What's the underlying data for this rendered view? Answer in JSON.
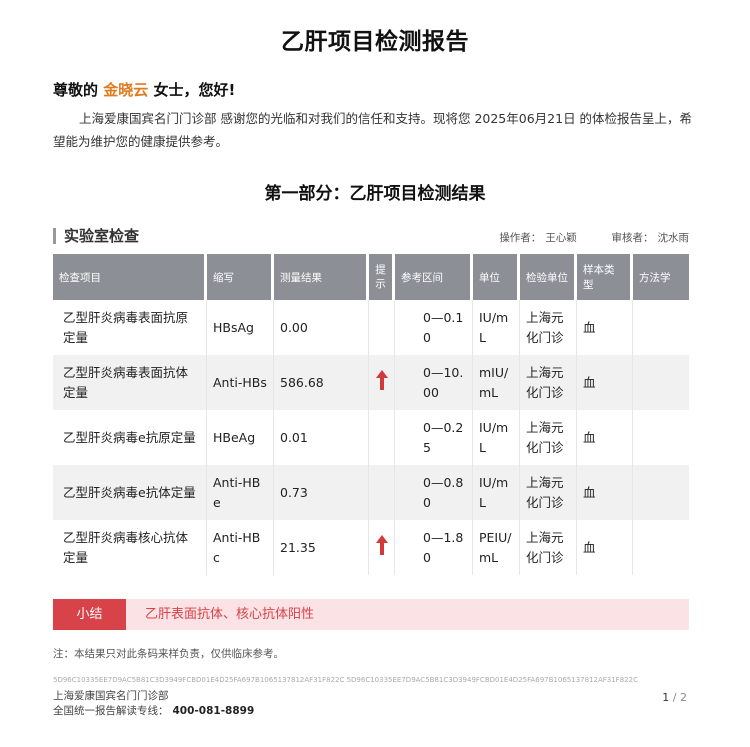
{
  "report": {
    "title": "乙肝项目检测报告"
  },
  "greeting": {
    "prefix": "尊敬的",
    "name": "金晓云",
    "suffix": "女士，您好!"
  },
  "intro": "上海爱康国宾名门门诊部 感谢您的光临和对我们的信任和支持。现将您 2025年06月21日 的体检报告呈上，希望能为维护您的健康提供参考。",
  "section": {
    "title": "第一部分：乙肝项目检测结果"
  },
  "lab": {
    "title": "实验室检查",
    "operator_label": "操作者：",
    "operator": "王心颖",
    "reviewer_label": "审核者：",
    "reviewer": "沈水雨"
  },
  "table": {
    "headers": [
      "检查项目",
      "缩写",
      "测量结果",
      "提示",
      "参考区间",
      "单位",
      "检验单位",
      "样本类型",
      "方法学"
    ],
    "rows": [
      {
        "item": "乙型肝炎病毒表面抗原定量",
        "abbr": "HBsAg",
        "result": "0.00",
        "flag": "",
        "range": "0—0.10",
        "unit": "IU/mL",
        "lab": "上海元化门诊",
        "sample": "血",
        "method": ""
      },
      {
        "item": "乙型肝炎病毒表面抗体定量",
        "abbr": "Anti-HBs",
        "result": "586.68",
        "flag": "up",
        "range": "0—10.00",
        "unit": "mIU/mL",
        "lab": "上海元化门诊",
        "sample": "血",
        "method": ""
      },
      {
        "item": "乙型肝炎病毒e抗原定量",
        "abbr": "HBeAg",
        "result": "0.01",
        "flag": "",
        "range": "0—0.25",
        "unit": "IU/mL",
        "lab": "上海元化门诊",
        "sample": "血",
        "method": ""
      },
      {
        "item": "乙型肝炎病毒e抗体定量",
        "abbr": "Anti-HBe",
        "result": "0.73",
        "flag": "",
        "range": "0—0.80",
        "unit": "IU/mL",
        "lab": "上海元化门诊",
        "sample": "血",
        "method": ""
      },
      {
        "item": "乙型肝炎病毒核心抗体定量",
        "abbr": "Anti-HBc",
        "result": "21.35",
        "flag": "up",
        "range": "0—1.80",
        "unit": "PEIU/mL",
        "lab": "上海元化门诊",
        "sample": "血",
        "method": ""
      }
    ]
  },
  "summary": {
    "label": "小结",
    "text": "乙肝表面抗体、核心抗体阳性"
  },
  "note": "注：本结果只对此条码来样负责，仅供临床参考。",
  "footer": {
    "hash": "5D96C10335EE7D9AC5B81C3D3949FCBD01E4D25FA697B1065137812AF31F822C  5D96C10335EE7D9AC5B81C3D3949FCBD01E4D25FA697B1065137812AF31F822C",
    "clinic": "上海爱康国宾名门门诊部",
    "hotline_label": "全国统一报告解读专线：",
    "hotline": "400-081-8899",
    "page_current": "1",
    "page_total": "/ 2"
  },
  "colors": {
    "accent_name": "#e07a1f",
    "alert_red": "#d23a3a",
    "summary_bg": "#fbe2e4",
    "header_gray": "#8c8f96"
  },
  "icons": {
    "flag_up": "arrow-up-icon"
  }
}
